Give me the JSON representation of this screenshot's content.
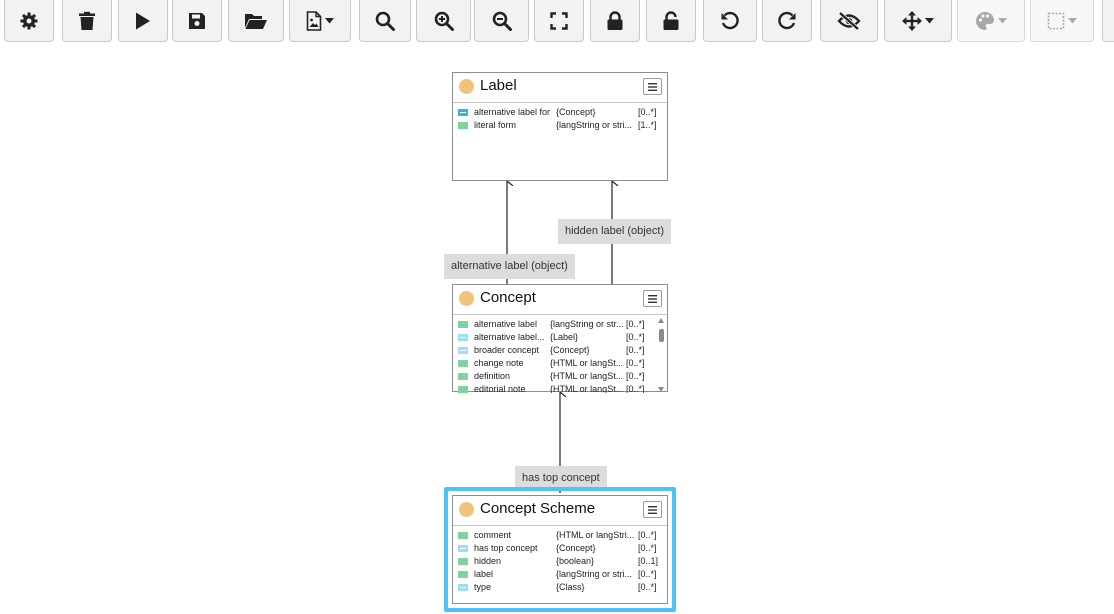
{
  "toolbar": {
    "buttons": [
      {
        "icon": "gear-icon"
      },
      {
        "icon": "trash-icon"
      },
      {
        "icon": "play-icon"
      },
      {
        "icon": "save-icon"
      },
      {
        "icon": "folder-open-icon"
      },
      {
        "icon": "export-image-icon",
        "dropdown": true
      },
      {
        "icon": "search-icon"
      },
      {
        "icon": "zoom-in-icon"
      },
      {
        "icon": "zoom-out-icon"
      },
      {
        "icon": "fit-screen-icon"
      },
      {
        "icon": "lock-icon"
      },
      {
        "icon": "unlock-icon"
      },
      {
        "icon": "undo-icon"
      },
      {
        "icon": "redo-icon"
      },
      {
        "icon": "eye-slash-icon"
      },
      {
        "icon": "move-arrows-icon",
        "dropdown": true
      },
      {
        "icon": "palette-icon",
        "dropdown": true,
        "disabled": true
      },
      {
        "icon": "frame-select-icon",
        "dropdown": true,
        "disabled": true
      }
    ]
  },
  "colors": {
    "class_dot": "#f0c27a",
    "datatype_property": "#7fd3a0",
    "object_property": "#9fdcef",
    "selection": "#4fc3f7"
  },
  "nodes": {
    "label": {
      "title": "Label",
      "rows": [
        {
          "kind": "link",
          "name": "alternative label for",
          "range": "{Concept}",
          "card": "[0..*]"
        },
        {
          "kind": "data",
          "name": "literal form",
          "range": "{langString or stri...",
          "card": "[1..*]"
        }
      ]
    },
    "concept": {
      "title": "Concept",
      "rows": [
        {
          "kind": "data",
          "name": "alternative label",
          "range": "{langString or str...",
          "card": "[0..*]"
        },
        {
          "kind": "obj",
          "name": "alternative label...",
          "range": "{Label}",
          "card": "[0..*]"
        },
        {
          "kind": "obj",
          "name": "broader concept",
          "range": "{Concept}",
          "card": "[0..*]"
        },
        {
          "kind": "data",
          "name": "change note",
          "range": "{HTML or langSt...",
          "card": "[0..*]"
        },
        {
          "kind": "data",
          "name": "definition",
          "range": "{HTML or langSt...",
          "card": "[0..*]"
        },
        {
          "kind": "data",
          "name": "editorial note",
          "range": "{HTML or langSt...",
          "card": "[0..*]"
        }
      ]
    },
    "concept_scheme": {
      "title": "Concept Scheme",
      "rows": [
        {
          "kind": "data",
          "name": "comment",
          "range": "{HTML or langStri...",
          "card": "[0..*]"
        },
        {
          "kind": "obj",
          "name": "has top concept",
          "range": "{Concept}",
          "card": "[0..*]"
        },
        {
          "kind": "data",
          "name": "hidden",
          "range": "{boolean}",
          "card": "[0..1]"
        },
        {
          "kind": "data",
          "name": "label",
          "range": "{langString or stri...",
          "card": "[0..*]"
        },
        {
          "kind": "obj",
          "name": "type",
          "range": "{Class}",
          "card": "[0..*]"
        }
      ]
    }
  },
  "edges": {
    "alt_label": "alternative label (object)",
    "hidden_label": "hidden label (object)",
    "has_top_concept": "has top concept"
  }
}
